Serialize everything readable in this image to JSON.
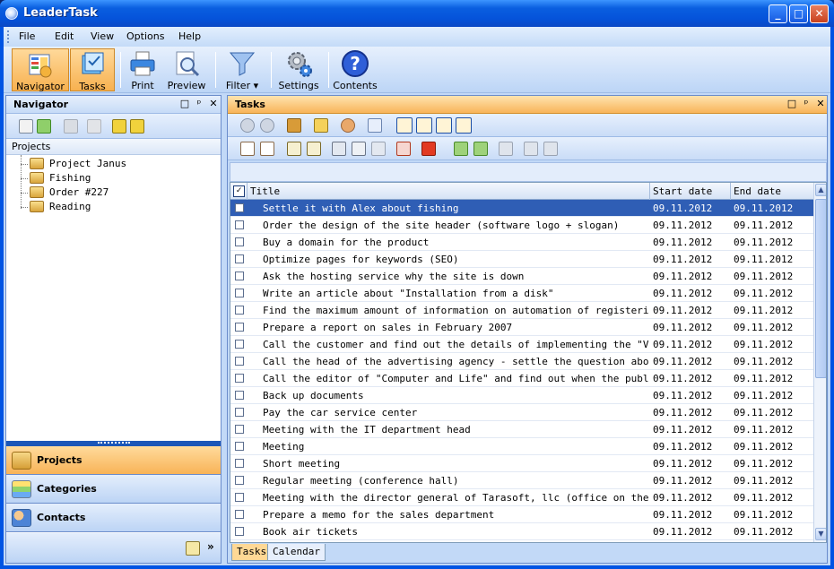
{
  "window": {
    "title": "LeaderTask",
    "controls": {
      "minimize": "_",
      "maximize": "□",
      "close": "✕"
    }
  },
  "menu": [
    "File",
    "Edit",
    "View",
    "Options",
    "Help"
  ],
  "toolbar": {
    "navigator": "Navigator",
    "tasks": "Tasks",
    "print": "Print",
    "preview": "Preview",
    "filter": "Filter",
    "settings": "Settings",
    "contents": "Contents",
    "filter_arrow": "▾"
  },
  "navigator": {
    "title": "Navigator",
    "header_controls": {
      "window": "□",
      "pin": "ᵖ",
      "close": "✕"
    },
    "tree_header": "Projects",
    "projects": [
      "Project Janus",
      "Fishing",
      "Order #227",
      "Reading"
    ],
    "sections": [
      {
        "label": "Projects",
        "icon": "briefcase-icon",
        "selected": true
      },
      {
        "label": "Categories",
        "icon": "categories-icon",
        "selected": false
      },
      {
        "label": "Contacts",
        "icon": "contacts-icon",
        "selected": false
      }
    ],
    "footer_more": "»"
  },
  "tasks": {
    "title": "Tasks",
    "header_controls": {
      "window": "□",
      "pin": "ᵖ",
      "close": "✕"
    },
    "columns": {
      "title": "Title",
      "start": "Start date",
      "end": "End date"
    },
    "check_all": "✓",
    "rows": [
      {
        "title": "Settle it with Alex about fishing",
        "start": "09.11.2012",
        "end": "09.11.2012",
        "selected": true
      },
      {
        "title": "Order the design of the site header (software logo + slogan)",
        "start": "09.11.2012",
        "end": "09.11.2012"
      },
      {
        "title": "Buy a domain for the product",
        "start": "09.11.2012",
        "end": "09.11.2012"
      },
      {
        "title": "Optimize pages for keywords (SEO)",
        "start": "09.11.2012",
        "end": "09.11.2012"
      },
      {
        "title": "Ask the hosting service why the site is down",
        "start": "09.11.2012",
        "end": "09.11.2012"
      },
      {
        "title": "Write an article about \"Installation from a disk\"",
        "start": "09.11.2012",
        "end": "09.11.2012"
      },
      {
        "title": "Find the maximum amount of information on automation of registering ...",
        "start": "09.11.2012",
        "end": "09.11.2012"
      },
      {
        "title": "Prepare a report on sales in February 2007",
        "start": "09.11.2012",
        "end": "09.11.2012"
      },
      {
        "title": "Call the customer and find out the details of implementing the \"Visi...",
        "start": "09.11.2012",
        "end": "09.11.2012"
      },
      {
        "title": "Call the head of the advertising agency - settle the question about ...",
        "start": "09.11.2012",
        "end": "09.11.2012"
      },
      {
        "title": "Call the editor of \"Computer and Life\" and find out when the publica...",
        "start": "09.11.2012",
        "end": "09.11.2012"
      },
      {
        "title": "Back up documents",
        "start": "09.11.2012",
        "end": "09.11.2012"
      },
      {
        "title": "Pay the car service center",
        "start": "09.11.2012",
        "end": "09.11.2012"
      },
      {
        "title": "Meeting with the IT department head",
        "start": "09.11.2012",
        "end": "09.11.2012"
      },
      {
        "title": "Meeting",
        "start": "09.11.2012",
        "end": "09.11.2012"
      },
      {
        "title": "Short meeting",
        "start": "09.11.2012",
        "end": "09.11.2012"
      },
      {
        "title": "Regular meeting (conference hall)",
        "start": "09.11.2012",
        "end": "09.11.2012"
      },
      {
        "title": "Meeting with the director general of Tarasoft, llc (office on the bank)",
        "start": "09.11.2012",
        "end": "09.11.2012"
      },
      {
        "title": "Prepare a memo for the sales department",
        "start": "09.11.2012",
        "end": "09.11.2012"
      },
      {
        "title": "Book air tickets",
        "start": "09.11.2012",
        "end": "09.11.2012"
      }
    ],
    "scroll": {
      "up": "▲",
      "down": "▼"
    },
    "bottom_tabs": [
      {
        "label": "Tasks",
        "active": true
      },
      {
        "label": "Calendar",
        "active": false
      }
    ]
  },
  "colors": {
    "titlebar": "#0553da",
    "active_orange": "#f8b357",
    "selection": "#2f5eb5",
    "panel_blue": "#c2d9f7"
  }
}
